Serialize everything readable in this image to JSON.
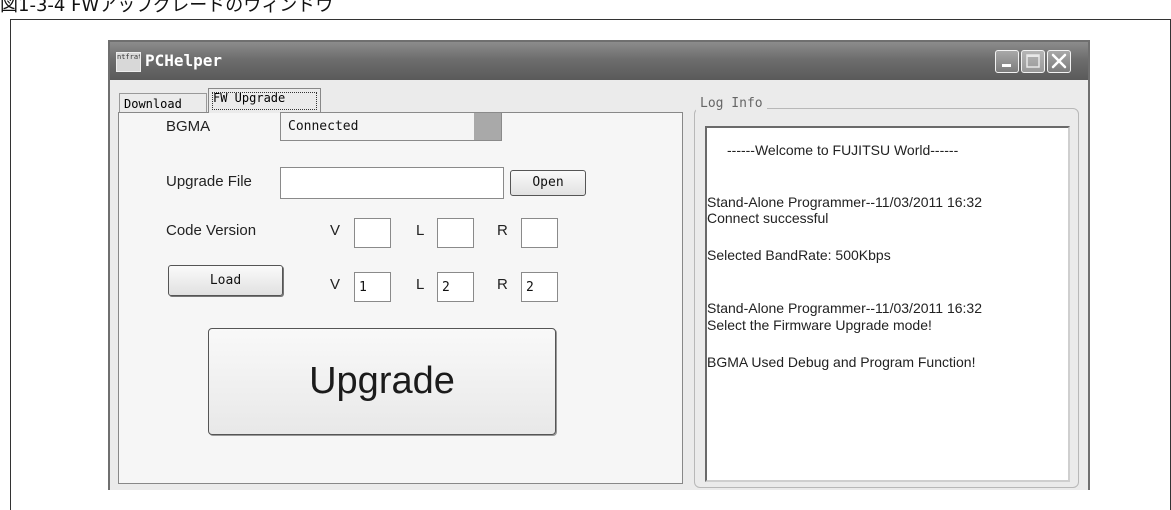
{
  "document": {
    "caption": "図1-3-4 FWアップグレードのウィンドウ"
  },
  "window": {
    "title": "PCHelper",
    "icon_text": "ntfrat"
  },
  "tabs": [
    {
      "label": "Download"
    },
    {
      "label": "FW Upgrade"
    }
  ],
  "form": {
    "bgma_label": "BGMA",
    "bgma_status": "Connected",
    "upgrade_file_label": "Upgrade File",
    "upgrade_file_value": "",
    "open_button": "Open",
    "code_version_label": "Code Version",
    "current_version": {
      "v_label": "V",
      "v": "",
      "l_label": "L",
      "l": "",
      "r_label": "R",
      "r": ""
    },
    "load_button": "Load",
    "loaded_version": {
      "v_label": "V",
      "v": "1",
      "l_label": "L",
      "l": "2",
      "r_label": "R",
      "r": "2"
    },
    "upgrade_button": "Upgrade"
  },
  "log": {
    "title": "Log Info",
    "lines": [
      "------Welcome to FUJITSU World------",
      "Stand-Alone Programmer--11/03/2011 16:32",
      "Connect successful",
      "Selected BandRate: 500Kbps",
      "Stand-Alone Programmer--11/03/2011 16:32",
      "Select the Firmware Upgrade mode!",
      "BGMA Used Debug and Program Function!"
    ]
  },
  "colors": {
    "title_bar": "#6d6d6d",
    "window_bg": "#ebebeb",
    "panel_bg": "#f6f6f6",
    "status_indicator": "#a9a9a9"
  }
}
